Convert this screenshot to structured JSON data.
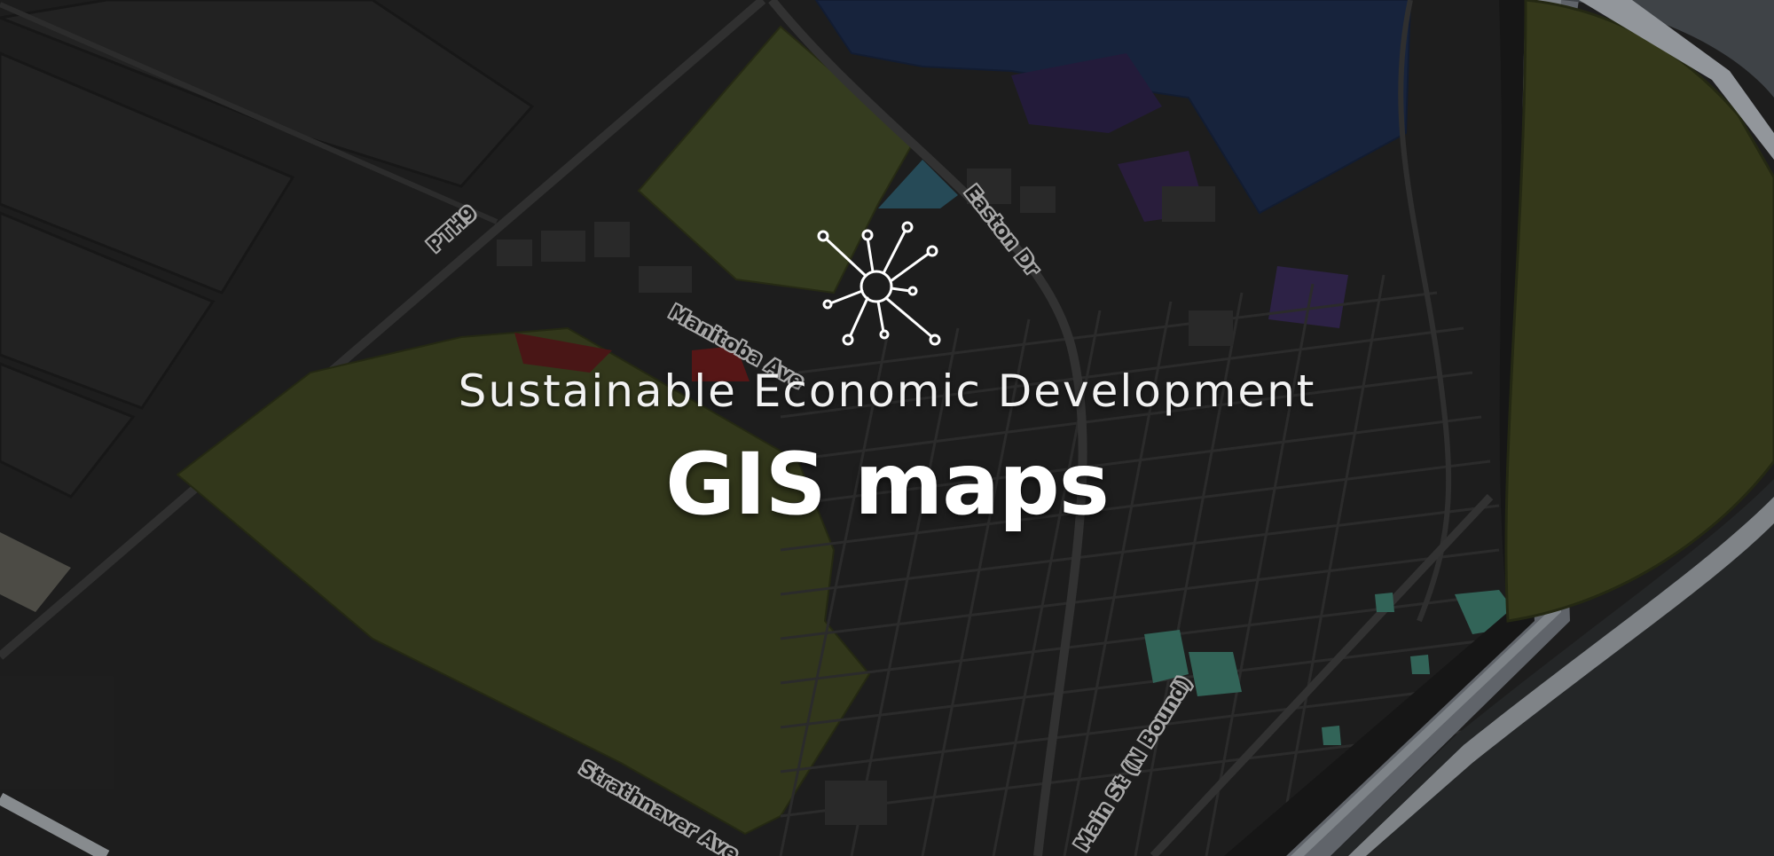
{
  "hero": {
    "subtitle": "Sustainable Economic Development",
    "title": "GIS maps",
    "icon": "network-hub-icon"
  },
  "map": {
    "road_labels": {
      "pth9": "PTH9",
      "easton": "Easton Dr",
      "manitoba": "Manitoba Ave",
      "strathnaver": "Strathnaver Ave",
      "main": "Main St (N Bound)"
    },
    "zone_colors": {
      "agricultural": "#4a5328",
      "industrial": "#1c2d4f",
      "institutional": "#3f4520",
      "residential-commercial": "#4a8c7c",
      "commercial": "#6a1c1c",
      "water-river": "#8a8f96",
      "base": "#262626"
    }
  }
}
